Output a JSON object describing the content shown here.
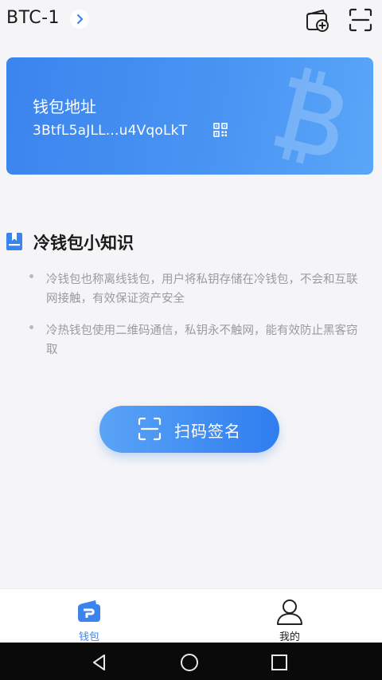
{
  "header": {
    "wallet_name": "BTC-1",
    "icons": [
      "chevron-right-icon",
      "add-wallet-icon",
      "scan-icon"
    ]
  },
  "address_card": {
    "title": "钱包地址",
    "address": "3BtfL5aJLL...u4VqoLkT",
    "icons": [
      "qr-code-icon",
      "bitcoin-watermark-icon"
    ]
  },
  "knowledge": {
    "title": "冷钱包小知识",
    "tips": [
      "冷钱包也称离线钱包，用户将私钥存储在冷钱包，不会和互联网接触，有效保证资产安全",
      "冷热钱包使用二维码通信，私钥永不触网，能有效防止黑客窃取"
    ]
  },
  "scan_button": {
    "label": "扫码签名",
    "icon": "scan-frame-icon"
  },
  "tabbar": {
    "items": [
      {
        "label": "钱包",
        "icon": "wallet-icon",
        "active": true
      },
      {
        "label": "我的",
        "icon": "user-icon",
        "active": false
      }
    ]
  },
  "colors": {
    "accent": "#3b84ee",
    "card_start": "#3b84ee",
    "card_end": "#5aa6f8",
    "tip_text": "#9a9aa0",
    "background": "#f5f5f7"
  }
}
